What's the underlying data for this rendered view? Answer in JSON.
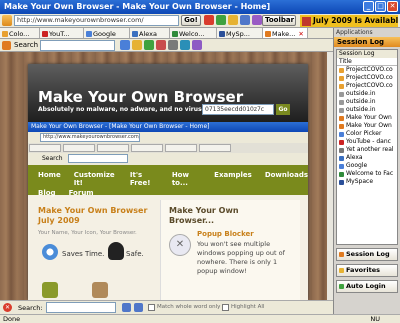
{
  "window": {
    "title": "Make Your Own Browser - Make Your Own Browser - Home]"
  },
  "nav": {
    "url": "http://www.makeyourownbrowser.com/",
    "go_label": "Go!",
    "toolbar_label": "Toolbar",
    "banner": "July 2009 Is Available"
  },
  "tabs": [
    {
      "label": "Colo...",
      "color": "#e8a030"
    },
    {
      "label": "YouT...",
      "color": "#cc2222"
    },
    {
      "label": "Google",
      "color": "#4a7fd8"
    },
    {
      "label": "Alexa",
      "color": "#3a6fc0"
    },
    {
      "label": "Welco...",
      "color": "#2f8a3a"
    },
    {
      "label": "MySp...",
      "color": "#2a4f99"
    },
    {
      "label": "Make...",
      "color": "#e07a20"
    }
  ],
  "search": {
    "label": "Search"
  },
  "panel": {
    "title": "Applications",
    "section": "Session Log",
    "subtitle": "Session Log",
    "column": "Title",
    "items": [
      "ProjectCOVO.co",
      "ProjectCOVO.co",
      "ProjectCOVO.co",
      "outside.in",
      "outside.in",
      "outside.in",
      "Make Your Own",
      "Make Your Own",
      "Color Picker",
      "YouTube - danc",
      "Yet another real",
      "Alexa",
      "Google",
      "Welcome to Fac",
      "MySpace"
    ],
    "buttons": [
      "Session Log",
      "Favorites",
      "Auto Login"
    ]
  },
  "site": {
    "title": "Make Your Own Browser",
    "tagline": "Absolutely no malware, no adware, and no viruses!",
    "code_box": "07135eecdd010z7c",
    "go": "Go",
    "inner_title": "Make Your Own Browser - [Make Your Own Browser - Home]",
    "inner_url": "http://www.makeyourownbrowser.com/",
    "inner_search": "Search",
    "menu": [
      "Home",
      "Customize It!",
      "It's Free!",
      "How to...",
      "Examples",
      "Downloads"
    ],
    "menu2": [
      "Blog",
      "Forum"
    ],
    "headline": "Make Your Own Browser July 2009",
    "subline": "Your Name, Your Icon, Your Browser.",
    "saves_time": "Saves Time.",
    "safe": "Safe.",
    "right_title": "Make Your Own Browser...",
    "popup_title": "Popup Blocker",
    "popup_text": "You won't see multiple windows popping up out of nowhere. There is only 1 popup window!"
  },
  "find": {
    "label": "Search:",
    "match": "Match whole word only",
    "highlight": "Highlight All"
  },
  "status": {
    "left": "Done",
    "right": "NU"
  }
}
